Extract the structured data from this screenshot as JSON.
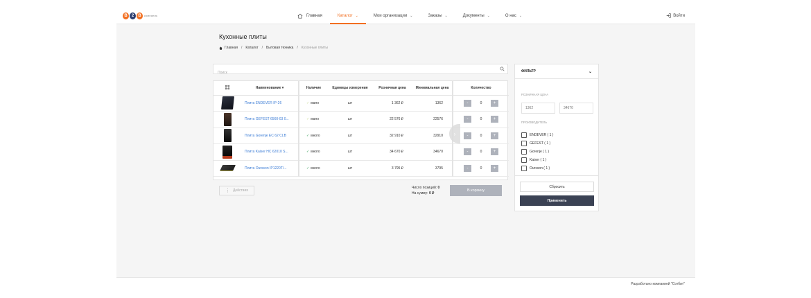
{
  "logo": {
    "text": "компаниь"
  },
  "nav": {
    "items": [
      {
        "label": "Главная",
        "icon": "home-icon"
      },
      {
        "label": "Каталог",
        "active": true
      },
      {
        "label": "Мои организации"
      },
      {
        "label": "Заказы"
      },
      {
        "label": "Документы"
      },
      {
        "label": "О нас"
      }
    ],
    "login_label": "Войти"
  },
  "page": {
    "title": "Кухонные плиты",
    "breadcrumb": [
      "Главная",
      "Каталог",
      "Бытовая техника",
      "Кухонные плиты"
    ]
  },
  "search": {
    "placeholder": "Поиск"
  },
  "table": {
    "headers": {
      "name": "Наименование",
      "availability": "Наличие",
      "unit": "Единицы измерения",
      "retail_price": "Розничная цена",
      "min_price": "Минимальная цена",
      "quantity": "Количество"
    },
    "rows": [
      {
        "name": "Плита ENDEVER IP-26",
        "availability": "мало",
        "level": "few",
        "unit": "шт",
        "retail_price": "1 362 ₽",
        "min_price": "1362",
        "qty": "0"
      },
      {
        "name": "Плита GEFEST 6560-03 0...",
        "availability": "мало",
        "level": "few",
        "unit": "шт",
        "retail_price": "22 576 ₽",
        "min_price": "22576",
        "qty": "0"
      },
      {
        "name": "Плита Gorenje EC 62 CLB",
        "availability": "много",
        "level": "many",
        "unit": "шт",
        "retail_price": "32 910 ₽",
        "min_price": "32910",
        "qty": "0"
      },
      {
        "name": "Плита Kaiser HC 62010 S...",
        "availability": "много",
        "level": "many",
        "unit": "шт",
        "retail_price": "34 670 ₽",
        "min_price": "34670",
        "qty": "0"
      },
      {
        "name": "Плита Oursson IP1220T/...",
        "availability": "много",
        "level": "many",
        "unit": "шт",
        "retail_price": "3 795 ₽",
        "min_price": "3795",
        "qty": "0"
      }
    ],
    "minus": "-",
    "plus": "+"
  },
  "footer_bar": {
    "actions_label": "Действия",
    "positions_label": "Число позиций:",
    "positions_value": "0",
    "sum_label": "На сумму:",
    "sum_value": "0 ₽",
    "cart_label": "В корзину"
  },
  "filter": {
    "title": "ФИЛЬТР",
    "price_label": "РОЗНИЧНАЯ ЦЕНА",
    "price_min": "1362",
    "price_max": "34670",
    "manufacturer_label": "ПРОИЗВОДИТЕЛЬ",
    "manufacturers": [
      "ENDEVER ( 1 )",
      "GEFEST ( 1 )",
      "Gorenje ( 1 )",
      "Kaiser ( 1 )",
      "Oursson ( 1 )"
    ],
    "reset_label": "Сбросить",
    "apply_label": "Применить"
  },
  "site_footer": {
    "text": "Разработано компанией \"Сотбит\""
  },
  "colors": {
    "accent": "#f26f21",
    "link": "#3a7bd5",
    "dark_button": "#3b4254",
    "muted_button": "#aeb2bb"
  }
}
